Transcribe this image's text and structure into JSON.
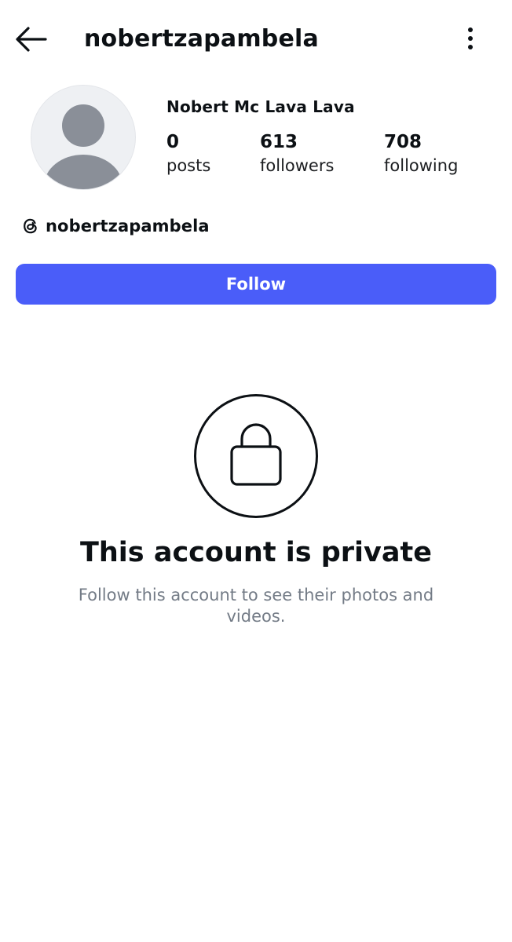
{
  "header": {
    "username": "nobertzapambela",
    "back_icon": "arrow-left-icon",
    "more_icon": "more-vertical-icon"
  },
  "profile": {
    "full_name": "Nobert Mc Lava Lava",
    "avatar_icon": "default-avatar-icon",
    "stats": [
      {
        "value": "0",
        "label": "posts"
      },
      {
        "value": "613",
        "label": "followers"
      },
      {
        "value": "708",
        "label": "following"
      }
    ],
    "threads": {
      "icon": "threads-icon",
      "handle": "nobertzapambela"
    }
  },
  "actions": {
    "follow_label": "Follow"
  },
  "private_notice": {
    "icon": "lock-icon",
    "title": "This account is private",
    "subtitle": "Follow this account to see their photos and videos."
  },
  "colors": {
    "accent": "#4a5df9",
    "text": "#0c1014",
    "muted": "#737b86",
    "avatar_bg": "#eef0f3",
    "avatar_fg": "#8a8f98"
  }
}
